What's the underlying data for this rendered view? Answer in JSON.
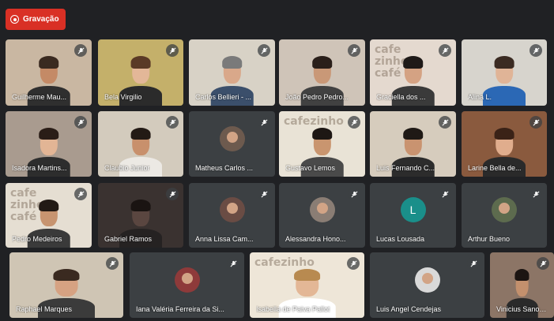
{
  "recording": {
    "label": "Gravação",
    "color": "#d93025"
  },
  "participants": [
    {
      "name": "Guilherme Mau...",
      "type": "video",
      "bg": "#c9b7a2",
      "skin": "#c48a66",
      "hair": "#3a2a20",
      "shirt": "#2f2f2f"
    },
    {
      "name": "Bela Virgilio",
      "type": "video",
      "bg": "#c4b06a",
      "skin": "#e3b798",
      "hair": "#5a3a26",
      "shirt": "#2b2b2b"
    },
    {
      "name": "Carlos Bellieri - ...",
      "type": "video",
      "bg": "#d8d2c6",
      "skin": "#d9a88a",
      "hair": "#7a7a7a",
      "shirt": "#3b4f6b"
    },
    {
      "name": "João Pedro Pedro...",
      "type": "video",
      "bg": "#cfc4b8",
      "skin": "#c99877",
      "hair": "#2a1f1a",
      "shirt": "#414141"
    },
    {
      "name": "Graciella dos ...",
      "type": "video",
      "bg": "#e4d9cf",
      "skin": "#d4a283",
      "hair": "#1f1a18",
      "shirt": "#3a3a3a",
      "brand": "cafe\nzinho\ncafé"
    },
    {
      "name": "Alina L.",
      "type": "video",
      "bg": "#d7d4cd",
      "skin": "#e0b497",
      "hair": "#3b2b22",
      "shirt": "#2b68b5"
    },
    {
      "name": "Isadora Martins...",
      "type": "video",
      "bg": "#a99b8f",
      "skin": "#e2b595",
      "hair": "#2a1d17",
      "shirt": "#2d2d2d"
    },
    {
      "name": "Claubio Junior",
      "type": "video",
      "bg": "#d3cbbd",
      "skin": "#c8906c",
      "hair": "#231a15",
      "shirt": "#ece9e4"
    },
    {
      "name": "Matheus Carlos ...",
      "type": "avatar",
      "avatar_bg": "#6d5a4e"
    },
    {
      "name": "Gustavo Lemos",
      "type": "video",
      "bg": "#e9e3d6",
      "skin": "#c9956f",
      "hair": "#1d1714",
      "shirt": "#4a4a4a",
      "brand": "cafezinho"
    },
    {
      "name": "Luis Fernando C...",
      "type": "video",
      "bg": "#d6ccbd",
      "skin": "#c99370",
      "hair": "#1f1915",
      "shirt": "#2c2c2c"
    },
    {
      "name": "Larine Bella de...",
      "type": "video",
      "bg": "#8a5a3e",
      "skin": "#e0ad8d",
      "hair": "#3a2217",
      "shirt": "#2a2a2a"
    },
    {
      "name": "Pedro Medeiros",
      "type": "video",
      "bg": "#e5ded2",
      "skin": "#c79470",
      "hair": "#221a15",
      "shirt": "#3a3a3a",
      "brand": "cafe\nzinho\ncafé"
    },
    {
      "name": "Gabriel Ramos",
      "type": "video",
      "bg": "#3a3230",
      "skin": "#5a4640",
      "hair": "#1a1412",
      "shirt": "#252222"
    },
    {
      "name": "Anna Lissa Cam...",
      "type": "avatar",
      "avatar_bg": "#6a4c44"
    },
    {
      "name": "Alessandra Hono...",
      "type": "avatar",
      "avatar_bg": "#8a7d74"
    },
    {
      "name": "Lucas Lousada",
      "type": "letter",
      "letter": "L",
      "avatar_bg": "#1a8f8a"
    },
    {
      "name": "Arthur Bueno",
      "type": "avatar",
      "avatar_bg": "#5d6b4e"
    },
    {
      "name": "Raphael Marques",
      "type": "video",
      "bg": "#cfc5b4",
      "skin": "#d6a282",
      "hair": "#3a2a20",
      "shirt": "#3b3b3b"
    },
    {
      "name": "Iana Valéria Ferreira da Si...",
      "type": "avatar",
      "avatar_bg": "#8e3a3a"
    },
    {
      "name": "Isabella de Paiva Pallot",
      "type": "video",
      "bg": "#eee6d8",
      "skin": "#e3b796",
      "hair": "#b88a50",
      "shirt": "#ffffff",
      "brand": "cafezinho"
    },
    {
      "name": "Luis Angel Cendejas",
      "type": "avatar",
      "avatar_bg": "#d9d9d9"
    },
    {
      "name": "Vinicius Sano A...",
      "type": "video",
      "bg": "#8c7566",
      "skin": "#c3906d",
      "hair": "#1c1512",
      "shirt": "#2a2a2a"
    }
  ]
}
